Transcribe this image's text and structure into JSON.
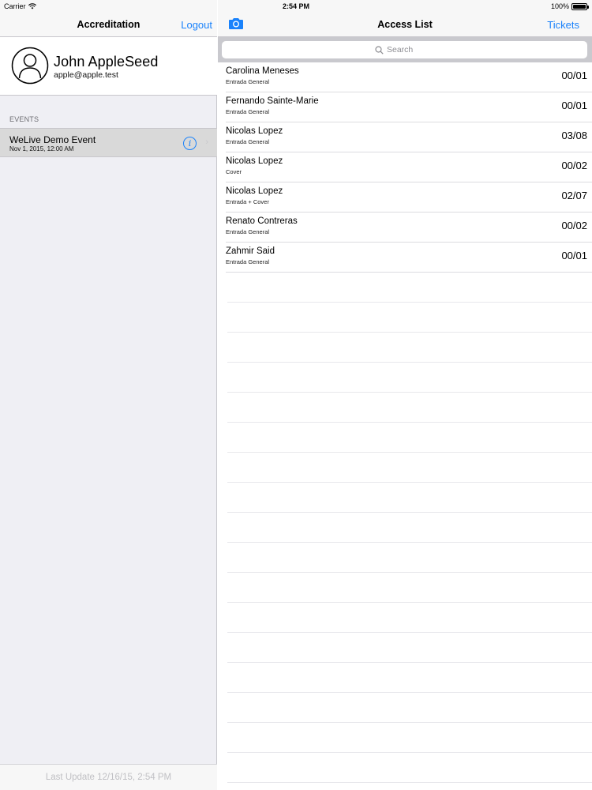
{
  "status_bar": {
    "carrier": "Carrier",
    "time": "2:54 PM",
    "battery": "100%"
  },
  "sidebar": {
    "nav_title": "Accreditation",
    "logout_label": "Logout",
    "profile": {
      "name": "John  AppleSeed",
      "email": "apple@apple.test"
    },
    "events_header": "EVENTS",
    "events": [
      {
        "title": "WeLive Demo Event",
        "date": "Nov 1, 2015, 12:00 AM"
      }
    ],
    "footer": "Last Update 12/16/15, 2:54 PM"
  },
  "main": {
    "nav_title": "Access List",
    "tickets_label": "Tickets",
    "search_placeholder": "Search",
    "rows": [
      {
        "name": "Carolina Meneses",
        "type": "Entrada General",
        "count": "00/01"
      },
      {
        "name": "Fernando Sainte-Marie",
        "type": "Entrada General",
        "count": "00/01"
      },
      {
        "name": "Nicolas Lopez",
        "type": "Entrada General",
        "count": "03/08"
      },
      {
        "name": "Nicolas Lopez",
        "type": "Cover",
        "count": "00/02"
      },
      {
        "name": "Nicolas Lopez",
        "type": "Entrada + Cover",
        "count": "02/07"
      },
      {
        "name": "Renato  Contreras",
        "type": "Entrada General",
        "count": "00/02"
      },
      {
        "name": "Zahmir Said",
        "type": "Entrada General",
        "count": "00/01"
      }
    ]
  },
  "colors": {
    "accent": "#1a82fb",
    "sidebar_bg": "#efeff4",
    "selected_row": "#d9d9d9"
  },
  "icons": [
    "wifi-icon",
    "battery-icon",
    "avatar-icon",
    "info-icon",
    "chevron-right-icon",
    "camera-icon",
    "search-icon"
  ]
}
